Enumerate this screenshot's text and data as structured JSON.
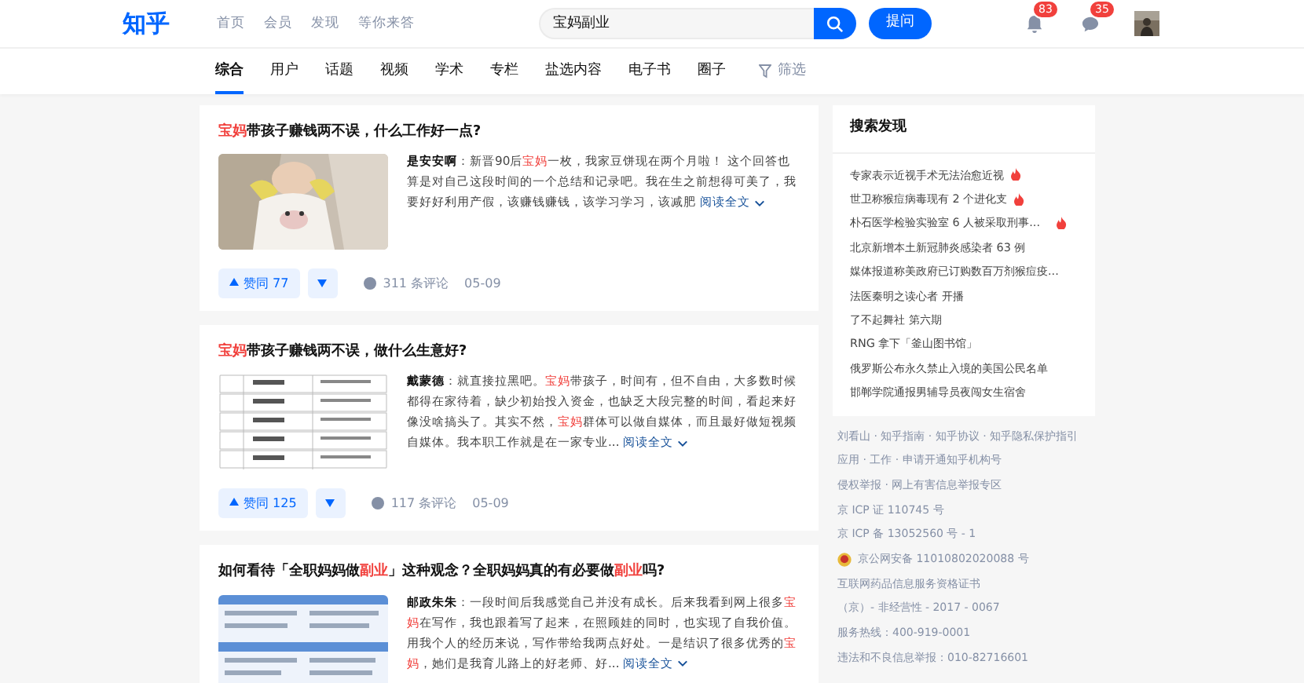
{
  "header": {
    "logo": "知乎",
    "nav": [
      {
        "label": "首页",
        "selected": false
      },
      {
        "label": "会员",
        "selected": false
      },
      {
        "label": "发现",
        "selected": false
      },
      {
        "label": "等你来答",
        "selected": false
      }
    ],
    "search": {
      "value": "宝妈副业"
    },
    "ask_button": "提问",
    "notifications": "83",
    "messages": "35"
  },
  "tabs": [
    {
      "label": "综合",
      "selected": true
    },
    {
      "label": "用户",
      "selected": false
    },
    {
      "label": "话题",
      "selected": false
    },
    {
      "label": "视频",
      "selected": false
    },
    {
      "label": "学术",
      "selected": false
    },
    {
      "label": "专栏",
      "selected": false
    },
    {
      "label": "盐选内容",
      "selected": false
    },
    {
      "label": "电子书",
      "selected": false
    },
    {
      "label": "圈子",
      "selected": false
    }
  ],
  "filter": "筛选",
  "results": [
    {
      "title": [
        {
          "text": "宝妈",
          "highlight": true
        },
        {
          "text": "带孩子赚钱两不误，什么工作好一点?",
          "highlight": false
        }
      ],
      "author": "是安安啊",
      "excerpt": [
        {
          "text": "：新晋90后",
          "highlight": false
        },
        {
          "text": "宝妈",
          "highlight": true
        },
        {
          "text": "一枚，我家豆饼现在两个月啦！ 这个回答也算是对自己这段时间的一个总结和记录吧。我在生之前想得可美了，我要好好利用产假，该赚钱赚钱，该学习学习，该减肥",
          "highlight": false
        }
      ],
      "read_more": "阅读全文",
      "upvote": "赞同 77",
      "comments": "311 条评论",
      "date": "05-09"
    },
    {
      "title": [
        {
          "text": "宝妈",
          "highlight": true
        },
        {
          "text": "带孩子赚钱两不误，做什么生意好?",
          "highlight": false
        }
      ],
      "author": "戴蒙德",
      "excerpt": [
        {
          "text": "：就直接拉黑吧。",
          "highlight": false
        },
        {
          "text": "宝妈",
          "highlight": true
        },
        {
          "text": "带孩子，时间有，但不自由，大多数时候都得在家待着，缺少初始投入资金，也缺乏大段完整的时间，看起来好像没啥搞头了。其实不然，",
          "highlight": false
        },
        {
          "text": "宝妈",
          "highlight": true
        },
        {
          "text": "群体可以做自媒体，而且最好做短视频自媒体。我本职工作就是在一家专业...",
          "highlight": false
        }
      ],
      "read_more": "阅读全文",
      "upvote": "赞同 125",
      "comments": "117 条评论",
      "date": "05-09"
    },
    {
      "title": [
        {
          "text": "如何看待「全职妈妈做",
          "highlight": false
        },
        {
          "text": "副业",
          "highlight": true
        },
        {
          "text": "」这种观念？全职妈妈真的有必要做",
          "highlight": false
        },
        {
          "text": "副业",
          "highlight": true
        },
        {
          "text": "吗?",
          "highlight": false
        }
      ],
      "author": "邮政朱朱",
      "excerpt": [
        {
          "text": "：一段时间后我感觉自己并没有成长。后来我看到网上很多",
          "highlight": false
        },
        {
          "text": "宝妈",
          "highlight": true
        },
        {
          "text": "在写作，我也跟着写了起来，在照顾娃的同时，也实现了自我价值。用我个人的经历来说，写作带给我两点好处。一是结识了很多优秀的",
          "highlight": false
        },
        {
          "text": "宝妈",
          "highlight": true
        },
        {
          "text": "，她们是我育儿路上的好老师、好...",
          "highlight": false
        }
      ],
      "read_more": "阅读全文"
    }
  ],
  "sidebar": {
    "title": "搜索发现",
    "items": [
      {
        "text": "专家表示近视手术无法治愈近视",
        "hot": true
      },
      {
        "text": "世卫称猴痘病毒现有 2 个进化支",
        "hot": true
      },
      {
        "text": "朴石医学检验实验室 6 人被采取刑事...",
        "hot": true
      },
      {
        "text": "北京新增本土新冠肺炎感染者 63 例",
        "hot": false
      },
      {
        "text": "媒体报道称美政府已订购数百万剂猴痘疫...",
        "hot": false
      },
      {
        "text": "法医秦明之读心者 开播",
        "hot": false
      },
      {
        "text": "了不起舞社 第六期",
        "hot": false
      },
      {
        "text": "RNG 拿下「釜山图书馆」",
        "hot": false
      },
      {
        "text": "俄罗斯公布永久禁止入境的美国公民名单",
        "hot": false
      },
      {
        "text": "邯郸学院通报男辅导员夜闯女生宿舍",
        "hot": false
      }
    ]
  },
  "footer": [
    {
      "text": "刘看山 · 知乎指南 · 知乎协议 · 知乎隐私保护指引",
      "badge": false
    },
    {
      "text": "应用 · 工作 · 申请开通知乎机构号",
      "badge": false
    },
    {
      "text": "侵权举报 · 网上有害信息举报专区",
      "badge": false
    },
    {
      "text": "京 ICP 证 110745 号",
      "badge": false
    },
    {
      "text": "京 ICP 备 13052560 号 - 1",
      "badge": false
    },
    {
      "text": "京公网安备 11010802020088 号",
      "badge": true
    },
    {
      "text": "互联网药品信息服务资格证书",
      "badge": false
    },
    {
      "text": "（京）- 非经营性 - 2017 - 0067",
      "badge": false
    },
    {
      "text": "服务热线：400-919-0001",
      "badge": false
    },
    {
      "text": "违法和不良信息举报：010-82716601",
      "badge": false
    }
  ]
}
